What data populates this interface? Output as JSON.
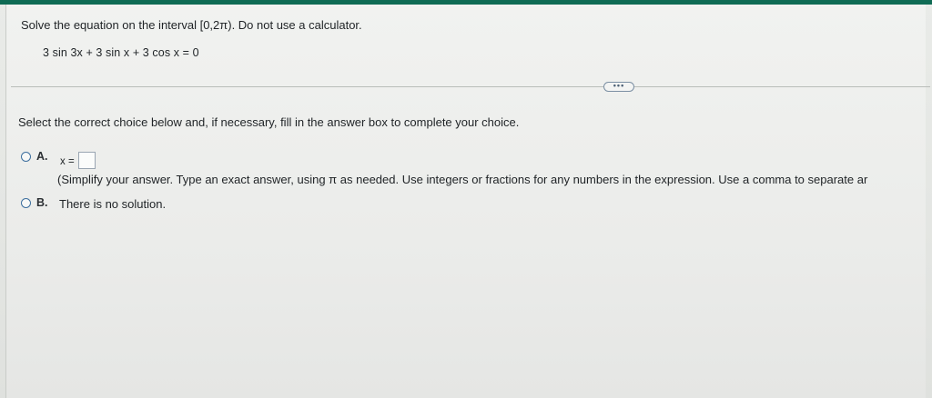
{
  "colors": {
    "accent_strip": "#0f6b54",
    "radio_border": "#3d6f9e",
    "text": "#1f2326"
  },
  "question": {
    "prompt": "Solve the equation on the interval [0,2π). Do not use a calculator.",
    "equation": "3 sin 3x + 3 sin x + 3 cos x = 0"
  },
  "toolbar": {
    "more_button_label": "•••"
  },
  "instruction": "Select the correct choice below and, if necessary, fill in the answer box to complete your choice.",
  "choices": [
    {
      "letter": "A.",
      "prefix": "x =",
      "answer_value": "",
      "hint": "(Simplify your answer. Type an exact answer, using π as needed. Use integers or fractions for any numbers in the expression. Use a comma to separate ar"
    },
    {
      "letter": "B.",
      "text": "There is no solution."
    }
  ]
}
